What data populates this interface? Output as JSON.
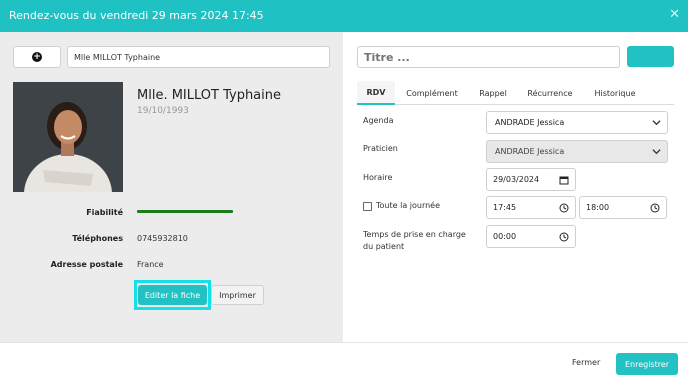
{
  "header": {
    "title": "Rendez-vous du vendredi 29 mars 2024 17:45",
    "close_glyph": "✕"
  },
  "left": {
    "add_glyph": "+",
    "patient_search_value": "Mlle MILLOT Typhaine",
    "patient_name": "Mlle. MILLOT Typhaine",
    "birth_date": "19/10/1993",
    "fiabilite_label": "Fiabilité",
    "fiabilite_level": 1.0,
    "telephones_label": "Téléphones",
    "telephones_value": "0745932810",
    "adresse_label": "Adresse postale",
    "adresse_value": "France",
    "edit_label": "Editer la fiche",
    "print_label": "Imprimer"
  },
  "right": {
    "title_placeholder": "Titre ...",
    "tabs": [
      {
        "label": "RDV",
        "active": true
      },
      {
        "label": "Complément"
      },
      {
        "label": "Rappel"
      },
      {
        "label": "Récurrence"
      },
      {
        "label": "Historique"
      }
    ],
    "agenda_label": "Agenda",
    "agenda_value": "ANDRADE Jessica",
    "praticien_label": "Praticien",
    "praticien_value": "ANDRADE Jessica",
    "horaire_label": "Horaire",
    "date_value": "29/03/2024",
    "allday_label": "Toute la journée",
    "start_time": "17:45",
    "end_time": "18:00",
    "prise_label": "Temps de prise en charge du patient",
    "prise_value": "00:00"
  },
  "footer": {
    "fermer_label": "Fermer",
    "save_label": "Enregistrer"
  },
  "colors": {
    "accent": "#22c1c3",
    "header": "#1fc1c3",
    "highlight": "#14e0ea",
    "fiabilite": "#1d7d1d"
  }
}
